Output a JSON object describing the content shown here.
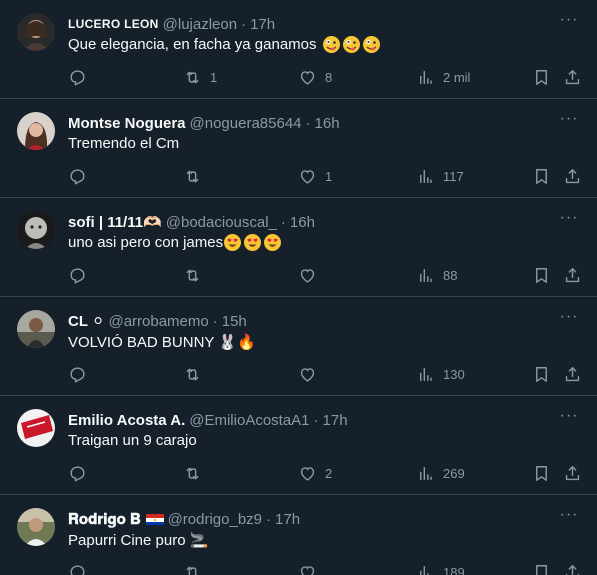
{
  "tweets": [
    {
      "name": "LUCERO LEON",
      "handle": "@lujazleon",
      "dot": "·",
      "time": "17h",
      "text": "Que elegancia, en facha ya ganamos",
      "emojis": [
        "zany-face",
        "zany-face",
        "zany-face"
      ],
      "replies": "",
      "retweets": "1",
      "likes": "8",
      "views": "2 mil"
    },
    {
      "name": "Montse Noguera",
      "handle": "@noguera85644",
      "dot": "·",
      "time": "16h",
      "text": "Tremendo el Cm",
      "emojis": [],
      "replies": "",
      "retweets": "",
      "likes": "1",
      "views": "117"
    },
    {
      "name": "sofi | 11/11🫶🏻",
      "handle": "@bodaciouscal_",
      "dot": "·",
      "time": "16h",
      "text": "uno asi pero con james",
      "emojis": [
        "heart-eyes-face",
        "heart-eyes-face",
        "heart-eyes-face"
      ],
      "replies": "",
      "retweets": "",
      "likes": "",
      "views": "88"
    },
    {
      "name": "CL ⚪",
      "handle": "@arrobamemo",
      "dot": "·",
      "time": "15h",
      "text": "VOLVIÓ BAD BUNNY 🐰🔥",
      "emojis": [],
      "replies": "",
      "retweets": "",
      "likes": "",
      "views": "130"
    },
    {
      "name": "Emilio Acosta A.",
      "handle": "@EmilioAcostaA1",
      "dot": "·",
      "time": "17h",
      "text": "Traigan un 9 carajo",
      "emojis": [],
      "replies": "",
      "retweets": "",
      "likes": "2",
      "views": "269"
    },
    {
      "name": "𝐑𝐨𝐝𝐫𝐢𝐠𝐨 𝐁",
      "handle": "@rodrigo_bz9",
      "dot": "·",
      "time": "17h",
      "text": "Papurri Cine puro 🚬",
      "emojis": [],
      "replies": "",
      "retweets": "",
      "likes": "",
      "views": "189"
    }
  ],
  "colors": {
    "background": "#15202b",
    "border": "#38444d",
    "text": "#f7f9f9",
    "muted": "#8b98a5"
  },
  "icons": [
    "reply-icon",
    "retweet-icon",
    "like-icon",
    "views-icon",
    "bookmark-icon",
    "share-icon",
    "more-icon",
    "paraguay-flag-icon"
  ]
}
